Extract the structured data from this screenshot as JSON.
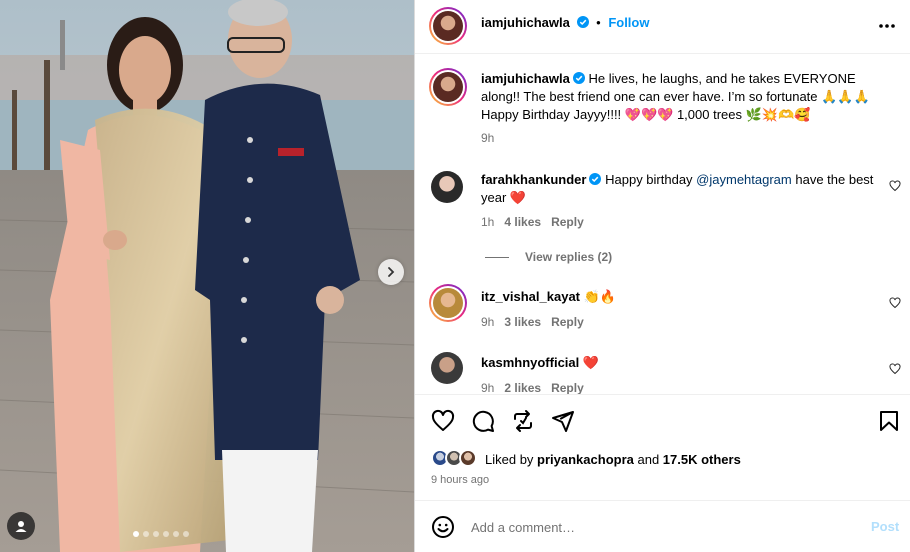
{
  "post": {
    "author": "iamjuhichawla",
    "follow_label": "Follow",
    "separator": "•",
    "caption": "He lives, he laughs, and he takes EVERYONE along!! The best friend one can ever have. I’m so fortunate 🙏🙏🙏 Happy Birthday Jayyy!!!! 💖💖💖 1,000 trees 🌿💥🫶🥰",
    "caption_time": "9h"
  },
  "comments": [
    {
      "user": "farahkhankunder",
      "text_before": "Happy birthday ",
      "mention": "@jaymehtagram",
      "text_after": " have the best year ❤️",
      "time": "1h",
      "likes": "4 likes",
      "reply": "Reply",
      "view_replies": "View replies (2)"
    },
    {
      "user": "itz_vishal_kayat",
      "text": "👏🔥",
      "time": "9h",
      "likes": "3 likes",
      "reply": "Reply"
    },
    {
      "user": "kasmhnyofficial",
      "text": "❤️",
      "time": "9h",
      "likes": "2 likes",
      "reply": "Reply"
    }
  ],
  "likes": {
    "prefix": "Liked by ",
    "user": "priyankachopra",
    "middle": " and ",
    "others": "17.5K others",
    "time_ago": "9 hours ago"
  },
  "add_comment": {
    "placeholder": "Add a comment…",
    "post_label": "Post"
  },
  "carousel": {
    "total_slides": 6,
    "active_index": 0
  },
  "colors": {
    "accent": "#0095f6",
    "muted": "#737373",
    "post_disabled": "#b2dffc",
    "like_red": "#ed4956"
  },
  "icons": [
    "more-options-icon",
    "verified-icon",
    "heart-icon",
    "comment-icon",
    "share-icon",
    "send-icon",
    "bookmark-icon",
    "emoji-icon",
    "chevron-right-icon",
    "user-tag-icon"
  ]
}
